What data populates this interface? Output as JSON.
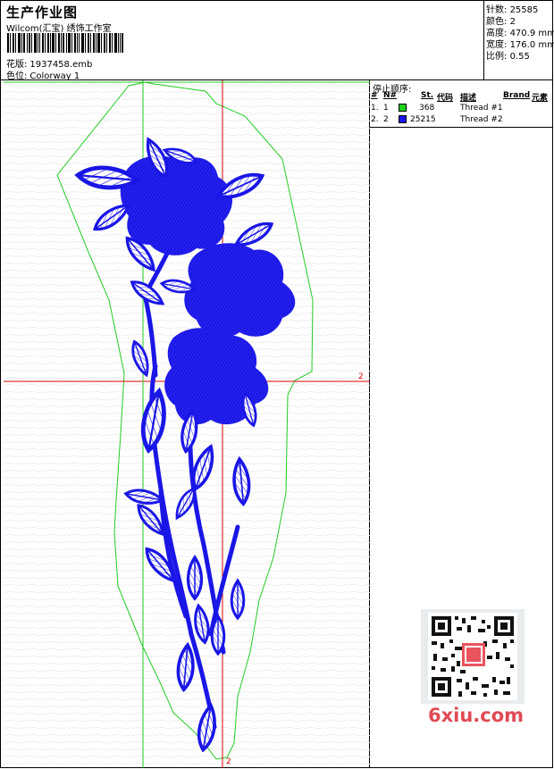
{
  "header": {
    "title": "生产作业图",
    "studio": "Wilcom(汇宝) 绣饰工作室",
    "design_label": "花版:",
    "design_file": "1937458.emb",
    "colorway_label": "色位:",
    "colorway": "Colorway 1"
  },
  "stats": [
    {
      "label": "针数:",
      "value": "25585"
    },
    {
      "label": "颜色:",
      "value": "2"
    },
    {
      "label": "高度:",
      "value": "470.9 mm"
    },
    {
      "label": "宽度:",
      "value": "176.0 mm"
    },
    {
      "label": "比例:",
      "value": "0.55"
    }
  ],
  "stops": {
    "title": "停止顺序:",
    "headers": {
      "num": "#",
      "no": "N#",
      "st": "St.",
      "code": "代码",
      "desc": "描述",
      "brand": "Brand",
      "element": "元素"
    },
    "rows": [
      {
        "num": "1.",
        "no": "1",
        "color": "#1bd11b",
        "code": "368",
        "desc": "Thread #1"
      },
      {
        "num": "2.",
        "no": "2",
        "color": "#1a16e6",
        "code": "25215",
        "desc": "Thread #2"
      }
    ]
  },
  "axis": {
    "label_right": "2",
    "label_bottom": "2"
  },
  "watermark": {
    "site": "6xiu.com"
  },
  "colors": {
    "outline": "#22cc22",
    "embroidery": "#1a16e6",
    "crosshair": "#e00000"
  }
}
